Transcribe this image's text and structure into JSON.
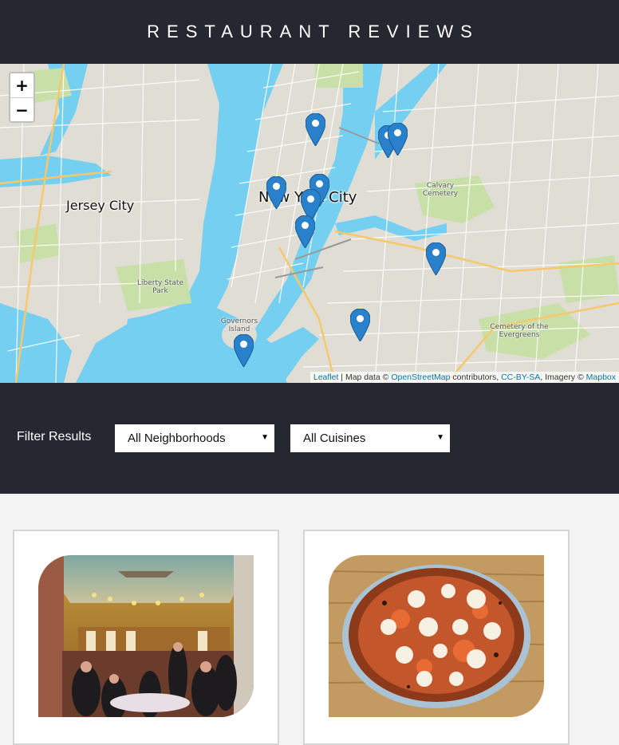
{
  "header": {
    "title": "RESTAURANT REVIEWS"
  },
  "map": {
    "zoom_in": "+",
    "zoom_out": "−",
    "labels": {
      "jersey_city": "Jersey City",
      "new_york_city": "New York City",
      "liberty_state_park": "Liberty State Park",
      "governors_island": "Governors Island",
      "calvary_cemetery": "Calvary Cemetery",
      "cemetery_evergreens": "Cemetery of the Evergreens"
    },
    "attribution": {
      "leaflet": "Leaflet",
      "sep": " | Map data © ",
      "osm": "OpenStreetMap",
      "contrib": " contributors, ",
      "license": "CC-BY-SA",
      "imagery": ", Imagery © ",
      "mapbox": "Mapbox"
    },
    "marker_color": "#2a81cb"
  },
  "filter": {
    "label": "Filter Results",
    "neighborhoods": {
      "selected": "All Neighborhoods"
    },
    "cuisines": {
      "selected": "All Cuisines"
    }
  },
  "restaurants": [
    {
      "image_alt": "restaurant interior"
    },
    {
      "image_alt": "pizza"
    }
  ]
}
